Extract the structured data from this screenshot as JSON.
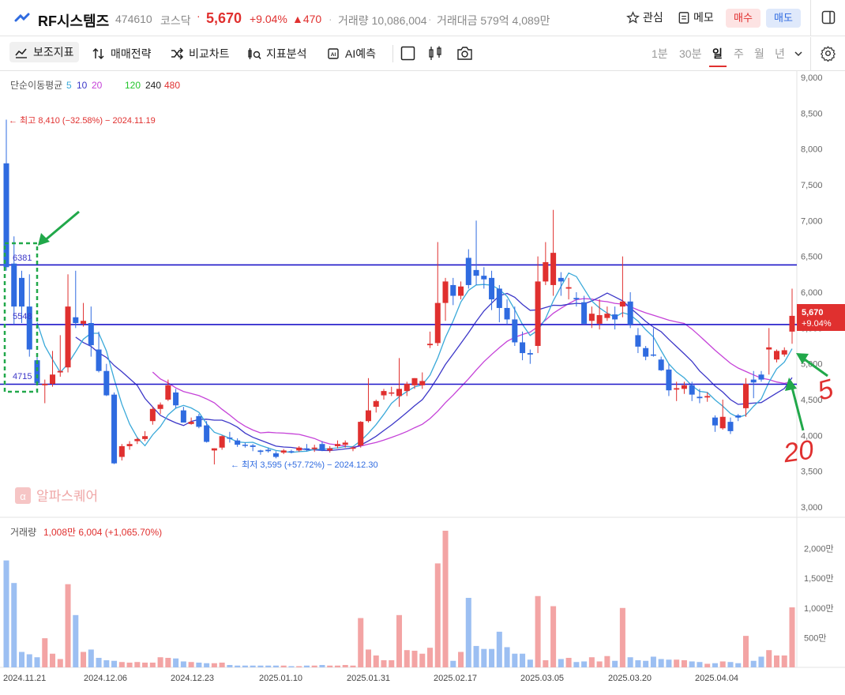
{
  "header": {
    "name": "RF시스템즈",
    "code": "474610",
    "market": "코스닥",
    "dot": "·",
    "price": "5,670",
    "change_pct": "+9.04%",
    "change_abs": "▲470",
    "sep": "·",
    "volume": "거래량 10,086,004",
    "amount": "거래대금 579억 4,089만",
    "fav_label": "관심",
    "memo_label": "메모",
    "buy_label": "매수",
    "sell_label": "매도"
  },
  "toolbar": {
    "tools": [
      "보조지표",
      "매매전략",
      "비교차트",
      "지표분석",
      "AI예측"
    ],
    "timeframes": [
      "1분",
      "30분",
      "일",
      "주",
      "월",
      "년"
    ],
    "selected_timeframe": "일"
  },
  "legend": {
    "label": "단순이동평균",
    "ma": [
      "5",
      "10",
      "20",
      "120",
      "240",
      "480"
    ],
    "colors": [
      "#3aa9d9",
      "#3c37c8",
      "#c542d8",
      "#22c52b",
      "#222222",
      "#e0302f"
    ]
  },
  "annotations": {
    "high": "← 최고 8,410 (−32.58%) − 2024.11.19",
    "low": "← 최저 3,595 (+57.72%) − 2024.12.30",
    "watermark": "알파스퀘어",
    "level1": "6381",
    "level2": "5548",
    "level3": "4715",
    "price_tag": "5,670",
    "price_tag_pct": "+9.04%",
    "hand_5": "5",
    "hand_20": "20"
  },
  "volume_panel": {
    "label": "거래량",
    "value": "1,008만 6,004 (+1,065.70%)"
  },
  "chart_data": {
    "type": "candlestick",
    "y_ticks": [
      "9,000",
      "8,500",
      "8,000",
      "7,500",
      "7,000",
      "6,500",
      "6,000",
      "5,500",
      "5,000",
      "4,500",
      "4,000",
      "3,500",
      "3,000"
    ],
    "ylim": [
      3000,
      9000
    ],
    "vol_ticks": [
      "2,000만",
      "1,500만",
      "1,000만",
      "500만"
    ],
    "x_labels": [
      "2024.11.21",
      "2024.12.06",
      "2024.12.23",
      "2025.01.10",
      "2025.01.31",
      "2025.02.17",
      "2025.03.05",
      "2025.03.20",
      "2025.04.04"
    ],
    "horizontal_levels": [
      6381,
      5548,
      4715
    ],
    "candles": [
      [
        7800,
        8410,
        6300,
        6350,
        1800
      ],
      [
        6400,
        6780,
        5550,
        5800,
        1420
      ],
      [
        6200,
        6300,
        5570,
        5800,
        260
      ],
      [
        5800,
        6250,
        5100,
        5200,
        220
      ],
      [
        5050,
        5100,
        4700,
        4730,
        170
      ],
      [
        4700,
        4780,
        4450,
        4720,
        490
      ],
      [
        4720,
        5180,
        4680,
        4850,
        230
      ],
      [
        4880,
        5400,
        4820,
        4900,
        140
      ],
      [
        4950,
        6250,
        4880,
        5800,
        1400
      ],
      [
        5650,
        6300,
        5500,
        5570,
        880
      ],
      [
        5560,
        5850,
        5520,
        5600,
        260
      ],
      [
        5570,
        5800,
        5100,
        5260,
        300
      ],
      [
        5200,
        5450,
        4880,
        4900,
        160
      ],
      [
        4900,
        5000,
        4550,
        4560,
        120
      ],
      [
        4570,
        4600,
        3600,
        3610,
        110
      ],
      [
        3700,
        3880,
        3650,
        3850,
        90
      ],
      [
        3850,
        3920,
        3800,
        3880,
        80
      ],
      [
        3920,
        3970,
        3880,
        3950,
        90
      ],
      [
        3950,
        4060,
        3920,
        3990,
        80
      ],
      [
        4200,
        4400,
        4150,
        4370,
        80
      ],
      [
        4370,
        4460,
        4300,
        4430,
        170
      ],
      [
        4500,
        4780,
        4480,
        4700,
        160
      ],
      [
        4600,
        4650,
        4380,
        4420,
        150
      ],
      [
        4350,
        4400,
        4180,
        4180,
        100
      ],
      [
        4160,
        4250,
        4150,
        4190,
        90
      ],
      [
        4270,
        4300,
        4100,
        4120,
        80
      ],
      [
        4140,
        4200,
        3900,
        3910,
        70
      ],
      [
        3790,
        3820,
        3595,
        3820,
        70
      ],
      [
        3830,
        4000,
        3800,
        3990,
        80
      ],
      [
        3970,
        4050,
        3900,
        3960,
        40
      ],
      [
        3930,
        3960,
        3840,
        3870,
        30
      ],
      [
        3870,
        3900,
        3830,
        3860,
        30
      ],
      [
        3860,
        3880,
        3780,
        3840,
        30
      ],
      [
        3790,
        3800,
        3730,
        3770,
        30
      ],
      [
        3800,
        3830,
        3760,
        3780,
        30
      ],
      [
        3750,
        3780,
        3680,
        3700,
        30
      ],
      [
        3760,
        3810,
        3740,
        3790,
        30
      ],
      [
        3780,
        3800,
        3750,
        3770,
        20
      ],
      [
        3790,
        3850,
        3770,
        3830,
        20
      ],
      [
        3820,
        3880,
        3780,
        3810,
        30
      ],
      [
        3810,
        3870,
        3770,
        3830,
        30
      ],
      [
        3880,
        3920,
        3780,
        3790,
        40
      ],
      [
        3790,
        3850,
        3760,
        3820,
        30
      ],
      [
        3850,
        3930,
        3820,
        3880,
        30
      ],
      [
        3870,
        3930,
        3830,
        3900,
        40
      ],
      [
        3820,
        3850,
        3780,
        3830,
        30
      ],
      [
        3860,
        4200,
        3830,
        4190,
        830
      ],
      [
        4200,
        4800,
        4180,
        4350,
        300
      ],
      [
        4400,
        4500,
        4320,
        4480,
        200
      ],
      [
        4560,
        4650,
        4500,
        4620,
        120
      ],
      [
        4600,
        4680,
        4550,
        4600,
        120
      ],
      [
        4550,
        5080,
        4400,
        4650,
        880
      ],
      [
        4620,
        4750,
        4550,
        4720,
        290
      ],
      [
        4700,
        4800,
        4650,
        4800,
        280
      ],
      [
        4700,
        4880,
        4650,
        4760,
        230
      ],
      [
        5260,
        5450,
        5220,
        5280,
        330
      ],
      [
        5290,
        6700,
        5250,
        5850,
        1750
      ],
      [
        5850,
        6200,
        5600,
        6150,
        2300
      ],
      [
        6100,
        6200,
        5820,
        5950,
        110
      ],
      [
        5950,
        6150,
        5900,
        6080,
        260
      ],
      [
        6480,
        6600,
        6050,
        6100,
        1170
      ],
      [
        6310,
        7000,
        6100,
        6230,
        360
      ],
      [
        6230,
        6350,
        6050,
        6180,
        310
      ],
      [
        6200,
        6300,
        5750,
        5900,
        310
      ],
      [
        6050,
        6100,
        5580,
        5780,
        600
      ],
      [
        5780,
        5900,
        5550,
        5620,
        340
      ],
      [
        5620,
        5800,
        5250,
        5300,
        230
      ],
      [
        5300,
        5450,
        5050,
        5150,
        230
      ],
      [
        5150,
        5200,
        5000,
        5130,
        130
      ],
      [
        5250,
        6500,
        5150,
        6150,
        1200
      ],
      [
        6150,
        6700,
        6100,
        6420,
        120
      ],
      [
        6100,
        7150,
        5950,
        6550,
        1030
      ],
      [
        6200,
        6280,
        5950,
        6150,
        140
      ],
      [
        6050,
        6200,
        5900,
        6070,
        160
      ],
      [
        5920,
        6000,
        5800,
        5900,
        90
      ],
      [
        5860,
        5950,
        5550,
        5560,
        100
      ],
      [
        5600,
        5800,
        5500,
        5700,
        170
      ],
      [
        5560,
        5900,
        5480,
        5680,
        100
      ],
      [
        5640,
        5800,
        5600,
        5700,
        190
      ],
      [
        5690,
        5800,
        5480,
        5620,
        110
      ],
      [
        5800,
        6500,
        5650,
        5870,
        1000
      ],
      [
        5870,
        6000,
        5500,
        5550,
        170
      ],
      [
        5400,
        5500,
        5150,
        5240,
        120
      ],
      [
        5220,
        5250,
        5050,
        5100,
        110
      ],
      [
        5130,
        5500,
        5100,
        5120,
        180
      ],
      [
        5060,
        5100,
        4900,
        4910,
        140
      ],
      [
        4920,
        5000,
        4550,
        4630,
        130
      ],
      [
        4640,
        4750,
        4480,
        4660,
        130
      ],
      [
        4650,
        4750,
        4580,
        4700,
        120
      ],
      [
        4700,
        4750,
        4480,
        4570,
        100
      ],
      [
        4540,
        4650,
        4450,
        4520,
        90
      ],
      [
        4530,
        4600,
        4470,
        4550,
        60
      ],
      [
        4250,
        4280,
        4050,
        4140,
        70
      ],
      [
        4100,
        4500,
        4080,
        4260,
        100
      ],
      [
        4190,
        4250,
        4020,
        4060,
        90
      ],
      [
        4280,
        4300,
        4200,
        4250,
        70
      ],
      [
        4380,
        4800,
        4260,
        4720,
        530
      ],
      [
        4780,
        4900,
        4520,
        4740,
        110
      ],
      [
        4850,
        4900,
        4750,
        4780,
        180
      ],
      [
        5200,
        5500,
        4850,
        5230,
        290
      ],
      [
        5060,
        5200,
        5020,
        5180,
        200
      ],
      [
        5130,
        5230,
        5100,
        5190,
        200
      ],
      [
        5450,
        6050,
        5280,
        5670,
        1010
      ]
    ]
  }
}
